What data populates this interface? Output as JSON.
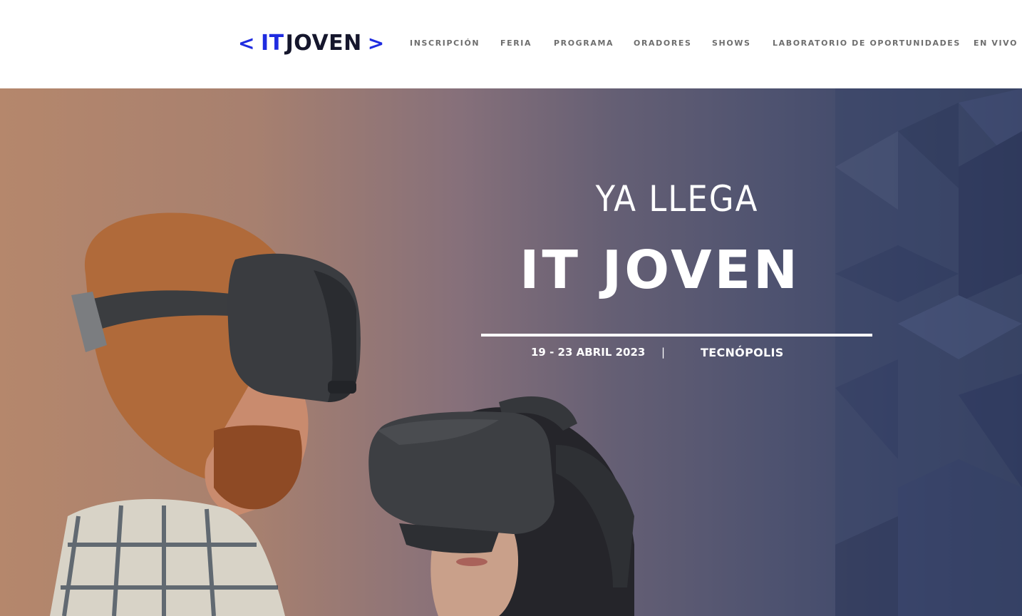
{
  "header": {
    "logo": {
      "open_bracket": "<",
      "it": "IT",
      "joven": "JOVEN",
      "close_bracket": ">"
    },
    "nav": [
      {
        "label": "INSCRIPCIÓN"
      },
      {
        "label": "FERIA"
      },
      {
        "label": "PROGRAMA"
      },
      {
        "label": "ORADORES"
      },
      {
        "label": "SHOWS"
      },
      {
        "label": "LABORATORIO DE OPORTUNIDADES"
      },
      {
        "label": "EN VIVO"
      }
    ]
  },
  "hero": {
    "pre_title": "YA LLEGA",
    "title": "IT JOVEN",
    "date": "19 - 23 ABRIL 2023",
    "separator": "|",
    "place": "TECNÓPOLIS",
    "image_subject": "two people wearing VR headsets"
  },
  "colors": {
    "brand_blue": "#1f2ce0",
    "brand_dark": "#15162c",
    "nav_text": "#6e6e6e",
    "hero_text": "#ffffff"
  }
}
